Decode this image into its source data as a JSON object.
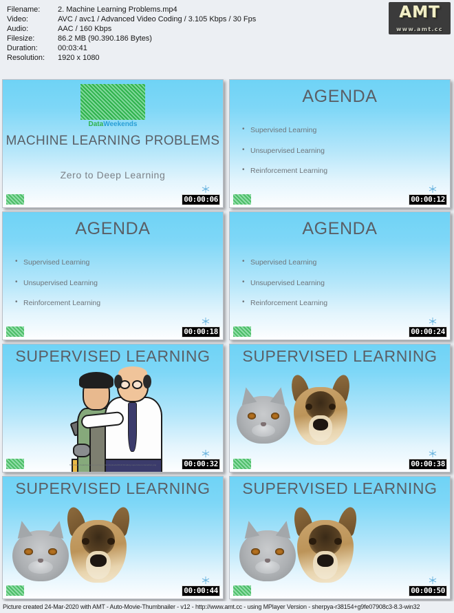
{
  "header": {
    "fields": [
      {
        "key": "Filename:",
        "value": "2. Machine Learning Problems.mp4"
      },
      {
        "key": "Video:",
        "value": "AVC / avc1 / Advanced Video Coding / 3.105 Kbps / 30 Fps"
      },
      {
        "key": "Audio:",
        "value": "AAC / 160 Kbps"
      },
      {
        "key": "Filesize:",
        "value": "86.2 MB (90.390.186 Bytes)"
      },
      {
        "key": "Duration:",
        "value": "00:03:41"
      },
      {
        "key": "Resolution:",
        "value": "1920 x 1080"
      }
    ],
    "logo": {
      "word": "AMT",
      "url": "www.amt.cc"
    }
  },
  "brand": {
    "logo_part_a": "Data",
    "logo_part_b": "Weekends"
  },
  "thumbnails": [
    {
      "kind": "title",
      "title": "MACHINE LEARNING PROBLEMS",
      "subtitle": "Zero to Deep Learning",
      "timestamp": "00:00:06"
    },
    {
      "kind": "agenda",
      "title": "AGENDA",
      "bullets": [
        "Supervised Learning",
        "Unsupervised Learning",
        "Reinforcement Learning"
      ],
      "timestamp": "00:00:12"
    },
    {
      "kind": "agenda",
      "title": "AGENDA",
      "bullets": [
        "Supervised Learning",
        "Unsupervised Learning",
        "Reinforcement Learning"
      ],
      "timestamp": "00:00:18"
    },
    {
      "kind": "agenda",
      "title": "AGENDA",
      "bullets": [
        "Supervised Learning",
        "Unsupervised Learning",
        "Reinforcement Learning"
      ],
      "timestamp": "00:00:24"
    },
    {
      "kind": "cartoon",
      "title": "SUPERVISED LEARNING",
      "caption": "http://www.creativitysgroup.com/wp-content/uploads/2014/11/safety-supervision-interaction.png",
      "timestamp": "00:00:32"
    },
    {
      "kind": "pets",
      "title": "SUPERVISED LEARNING",
      "timestamp": "00:00:38"
    },
    {
      "kind": "pets-large",
      "title": "SUPERVISED LEARNING",
      "timestamp": "00:00:44"
    },
    {
      "kind": "pets-large",
      "title": "SUPERVISED LEARNING",
      "timestamp": "00:00:50"
    }
  ],
  "footer": {
    "text": "Picture created 24-Mar-2020 with AMT - Auto-Movie-Thumbnailer - v12 - http://www.amt.cc - using MPlayer Version - sherpya-r38154+g9fe07908c3-8.3-win32"
  }
}
